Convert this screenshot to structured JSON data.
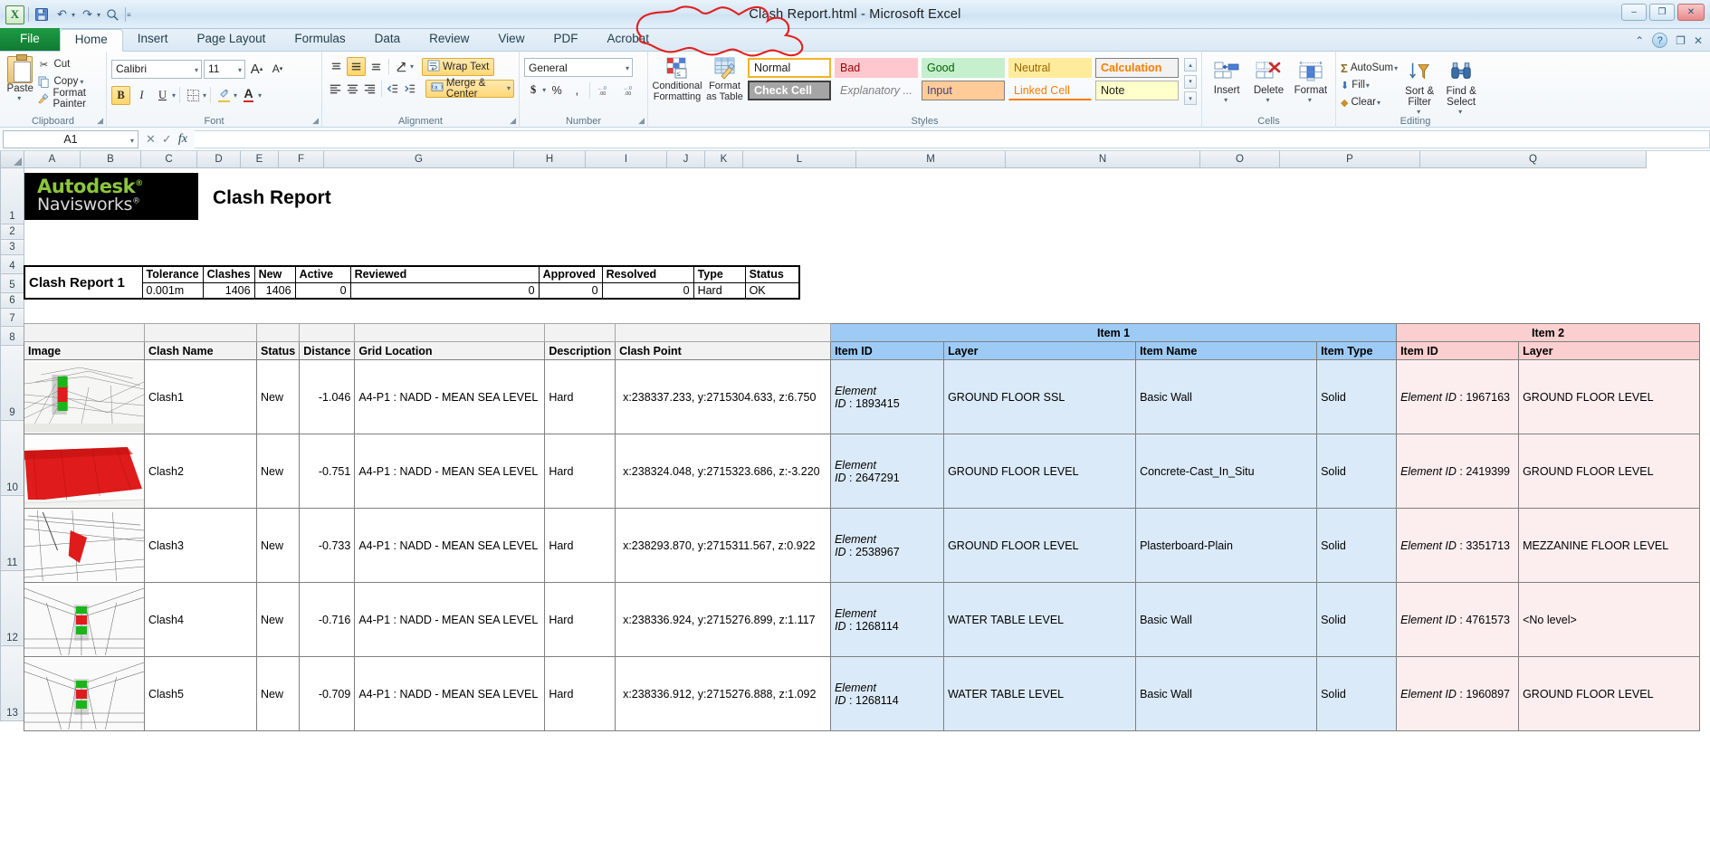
{
  "window": {
    "title": "Clash Report.html  -  Microsoft Excel",
    "minimize": "–",
    "maximize": "❐",
    "close": "✕"
  },
  "qat": {
    "excel_logo": "X",
    "save": "💾",
    "undo": "↶",
    "redo": "↷",
    "print_preview": "🔍",
    "customize": "≡"
  },
  "tabs": [
    {
      "label": "File",
      "type": "file"
    },
    {
      "label": "Home",
      "type": "active"
    },
    {
      "label": "Insert",
      "type": "normal"
    },
    {
      "label": "Page Layout",
      "type": "normal"
    },
    {
      "label": "Formulas",
      "type": "normal"
    },
    {
      "label": "Data",
      "type": "normal"
    },
    {
      "label": "Review",
      "type": "normal"
    },
    {
      "label": "View",
      "type": "normal"
    },
    {
      "label": "PDF",
      "type": "normal"
    },
    {
      "label": "Acrobat",
      "type": "normal"
    }
  ],
  "tabbar_right": {
    "help": "?",
    "minimize_ribbon": "⌃",
    "restore": "❐",
    "close": "✕"
  },
  "ribbon": {
    "clipboard": {
      "group_label": "Clipboard",
      "paste": "Paste",
      "cut": "Cut",
      "copy": "Copy",
      "format_painter": "Format Painter"
    },
    "font": {
      "group_label": "Font",
      "font_name": "Calibri",
      "font_size": "11",
      "grow_font": "A",
      "shrink_font": "A",
      "bold": "B",
      "italic": "I",
      "underline": "U",
      "borders": "▦",
      "fill_color": "◆",
      "font_color": "A"
    },
    "alignment": {
      "group_label": "Alignment",
      "top_align": "≡",
      "middle_align": "≡",
      "bottom_align": "≡",
      "orientation": "⤨",
      "align_left": "≡",
      "align_center": "≡",
      "align_right": "≡",
      "decrease_indent": "⇤",
      "increase_indent": "⇥",
      "wrap_text": "Wrap Text",
      "merge_center": "Merge & Center"
    },
    "number": {
      "group_label": "Number",
      "format": "General",
      "currency": "$",
      "percent": "%",
      "comma": ",",
      "increase_decimal": ".00",
      "decrease_decimal": ".00"
    },
    "styles": {
      "group_label": "Styles",
      "conditional_formatting": "Conditional Formatting",
      "format_as_table": "Format as Table",
      "cells": [
        {
          "label": "Normal",
          "class": "normal"
        },
        {
          "label": "Bad",
          "class": "bad"
        },
        {
          "label": "Good",
          "class": "good"
        },
        {
          "label": "Neutral",
          "class": "neutral"
        },
        {
          "label": "Calculation",
          "class": "calc"
        },
        {
          "label": "Check Cell",
          "class": "check"
        },
        {
          "label": "Explanatory ...",
          "class": "expl"
        },
        {
          "label": "Input",
          "class": "input"
        },
        {
          "label": "Linked Cell",
          "class": "linked"
        },
        {
          "label": "Note",
          "class": "note"
        }
      ]
    },
    "cells": {
      "group_label": "Cells",
      "insert": "Insert",
      "delete": "Delete",
      "format": "Format"
    },
    "editing": {
      "group_label": "Editing",
      "autosum": "AutoSum",
      "fill": "Fill",
      "clear": "Clear",
      "sort_filter": "Sort & Filter",
      "find_select": "Find & Select"
    }
  },
  "formula_bar": {
    "name_box": "A1",
    "cancel": "✕",
    "enter": "✓",
    "insert_function": "fx",
    "content": ""
  },
  "grid": {
    "columns": [
      "A",
      "B",
      "C",
      "D",
      "E",
      "F",
      "G",
      "H",
      "I",
      "J",
      "K",
      "L",
      "M",
      "N",
      "O",
      "P",
      "Q"
    ],
    "rows": [
      "1",
      "2",
      "3",
      "4",
      "5",
      "6",
      "7",
      "8",
      "9",
      "10",
      "11",
      "12",
      "13"
    ]
  },
  "report": {
    "logo": {
      "autodesk": "Autodesk",
      "navisworks": "Navisworks",
      "registered": "®"
    },
    "title": "Clash Report",
    "summary": {
      "name": "Clash Report 1",
      "headers": [
        "Tolerance",
        "Clashes",
        "New",
        "Active",
        "Reviewed",
        "Approved",
        "Resolved",
        "Type",
        "Status"
      ],
      "values": [
        "0.001m",
        "1406",
        "1406",
        "0",
        "0",
        "0",
        "0",
        "Hard",
        "OK"
      ]
    },
    "group_headers": [
      {
        "label": "Item 1",
        "color": "blue"
      },
      {
        "label": "Item 2",
        "color": "pink"
      }
    ],
    "columns": [
      "Image",
      "Clash Name",
      "Status",
      "Distance",
      "Grid Location",
      "Description",
      "Clash Point",
      "Item ID",
      "Layer",
      "Item Name",
      "Item Type",
      "Item ID",
      "Layer"
    ],
    "rows": [
      {
        "row_number": "9",
        "clash_name": "Clash1",
        "status": "New",
        "distance": "-1.046",
        "grid_location": "A4-P1 : NADD - MEAN SEA LEVEL",
        "description": "Hard",
        "clash_point": "x:238337.233, y:2715304.633, z:6.750",
        "item1_id_label": "Element ID",
        "item1_id": "1893415",
        "item1_layer": "GROUND FLOOR SSL",
        "item1_name": "Basic Wall",
        "item1_type": "Solid",
        "item2_id_label": "Element ID",
        "item2_id": "1967163",
        "item2_layer": "GROUND FLOOR LEVEL"
      },
      {
        "row_number": "10",
        "clash_name": "Clash2",
        "status": "New",
        "distance": "-0.751",
        "grid_location": "A4-P1 : NADD - MEAN SEA LEVEL",
        "description": "Hard",
        "clash_point": "x:238324.048, y:2715323.686, z:-3.220",
        "item1_id_label": "Element ID",
        "item1_id": "2647291",
        "item1_layer": "GROUND FLOOR LEVEL",
        "item1_name": "Concrete-Cast_In_Situ",
        "item1_type": "Solid",
        "item2_id_label": "Element ID",
        "item2_id": "2419399",
        "item2_layer": "GROUND FLOOR LEVEL"
      },
      {
        "row_number": "11",
        "clash_name": "Clash3",
        "status": "New",
        "distance": "-0.733",
        "grid_location": "A4-P1 : NADD - MEAN SEA LEVEL",
        "description": "Hard",
        "clash_point": "x:238293.870, y:2715311.567, z:0.922",
        "item1_id_label": "Element ID",
        "item1_id": "2538967",
        "item1_layer": "GROUND FLOOR LEVEL",
        "item1_name": "Plasterboard-Plain",
        "item1_type": "Solid",
        "item2_id_label": "Element ID",
        "item2_id": "3351713",
        "item2_layer": "MEZZANINE FLOOR LEVEL"
      },
      {
        "row_number": "12",
        "clash_name": "Clash4",
        "status": "New",
        "distance": "-0.716",
        "grid_location": "A4-P1 : NADD - MEAN SEA LEVEL",
        "description": "Hard",
        "clash_point": "x:238336.924, y:2715276.899, z:1.117",
        "item1_id_label": "Element ID",
        "item1_id": "1268114",
        "item1_layer": "WATER TABLE LEVEL",
        "item1_name": "Basic Wall",
        "item1_type": "Solid",
        "item2_id_label": "Element ID",
        "item2_id": "4761573",
        "item2_layer": "<No level>"
      },
      {
        "row_number": "13",
        "clash_name": "Clash5",
        "status": "New",
        "distance": "-0.709",
        "grid_location": "A4-P1 : NADD - MEAN SEA LEVEL",
        "description": "Hard",
        "clash_point": "x:238336.912, y:2715276.888, z:1.092",
        "item1_id_label": "Element ID",
        "item1_id": "1268114",
        "item1_layer": "WATER TABLE LEVEL",
        "item1_name": "Basic Wall",
        "item1_type": "Solid",
        "item2_id_label": "Element ID",
        "item2_id": "1960897",
        "item2_layer": "GROUND FLOOR LEVEL"
      }
    ]
  },
  "annotation": {
    "color": "#e02020",
    "shape": "hand-drawn-ellipse-around-title"
  }
}
